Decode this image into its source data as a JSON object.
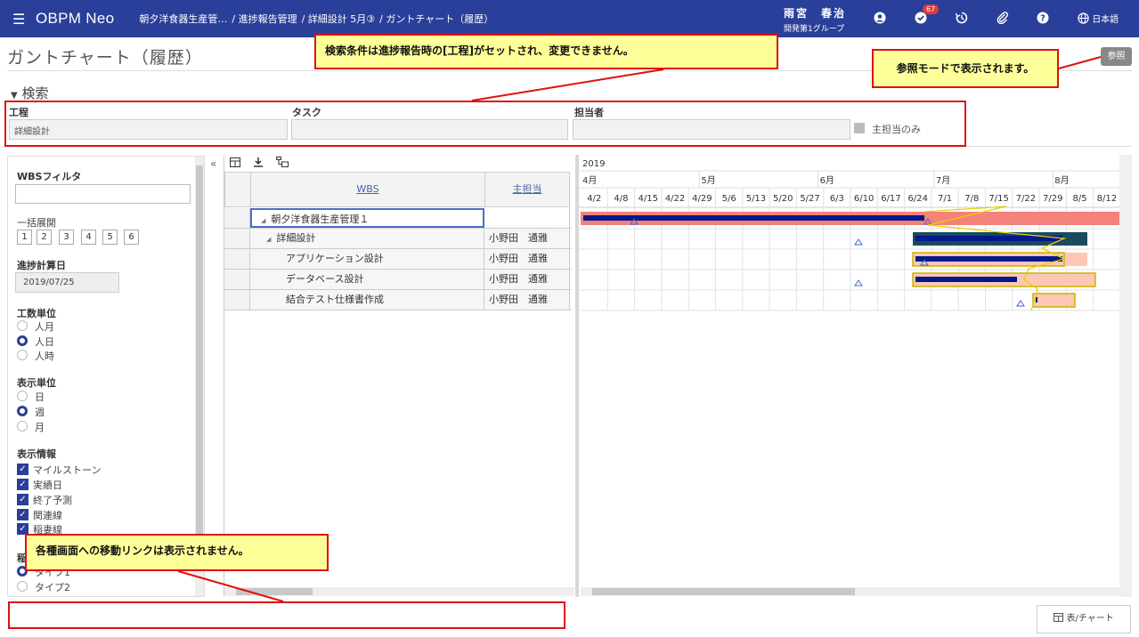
{
  "header": {
    "brand": "OBPM Neo",
    "breadcrumbs": [
      "朝夕洋食器生産管…",
      "/ 進捗報告管理",
      "/ 詳細設計 5月③",
      "/ ガントチャート（履歴）"
    ],
    "user_name": "雨宮　春治",
    "user_group": "開発第1グループ",
    "notification_count": "67",
    "language": "日本語"
  },
  "page": {
    "title": "ガントチャート（履歴）",
    "reference_button": "参照"
  },
  "search": {
    "heading": "検索",
    "process_label": "工程",
    "process_value": "詳細設計",
    "task_label": "タスク",
    "task_value": "",
    "owner_label": "担当者",
    "owner_value": "",
    "main_owner_only": "主担当のみ"
  },
  "sidebar": {
    "wbs_filter_label": "WBSフィルタ",
    "expand_label": "一括展開",
    "expand_levels": [
      "1",
      "2",
      "3",
      "4",
      "5",
      "6"
    ],
    "calc_date_label": "進捗計算日",
    "calc_date_value": "2019/07/25",
    "effort_unit_label": "工数単位",
    "effort_units": [
      "人月",
      "人日",
      "人時"
    ],
    "display_unit_label": "表示単位",
    "display_units": [
      "日",
      "週",
      "月"
    ],
    "display_info_label": "表示情報",
    "display_info": [
      "マイルストーン",
      "実績日",
      "終了予測",
      "関連線",
      "稲妻線"
    ],
    "type_label": "稲",
    "types": [
      "タイプ1",
      "タイプ2"
    ]
  },
  "grid": {
    "col_wbs": "WBS",
    "col_owner": "主担当",
    "rows": [
      {
        "name": "朝夕洋食器生産管理１",
        "owner": "",
        "toggle": "◢"
      },
      {
        "name": "詳細設計",
        "owner": "小野田　通雅",
        "toggle": "◢"
      },
      {
        "name": "アプリケーション設計",
        "owner": "小野田　通雅",
        "toggle": ""
      },
      {
        "name": "データベース設計",
        "owner": "小野田　通雅",
        "toggle": ""
      },
      {
        "name": "結合テスト仕様書作成",
        "owner": "小野田　通雅",
        "toggle": ""
      }
    ]
  },
  "gantt": {
    "year": "2019",
    "months": [
      "4月",
      "5月",
      "6月",
      "7月",
      "8月"
    ],
    "weeks": [
      "4/2",
      "4/8",
      "4/15",
      "4/22",
      "4/29",
      "5/6",
      "5/13",
      "5/20",
      "5/27",
      "6/3",
      "6/10",
      "6/17",
      "6/24",
      "7/1",
      "7/8",
      "7/15",
      "7/22",
      "7/29",
      "8/5",
      "8/12"
    ]
  },
  "callouts": {
    "search_note": "検索条件は進捗報告時の[工程]がセットされ、変更できません。",
    "ref_note": "参照モードで表示されます。",
    "link_note": "各種画面への移動リンクは表示されません。"
  },
  "footer": {
    "table_chart_button": "表/チャート"
  },
  "colors": {
    "header_bg": "#2a3f99",
    "accent": "#2a3f99",
    "callout_border": "#e01010",
    "callout_bg": "#ffff99"
  }
}
